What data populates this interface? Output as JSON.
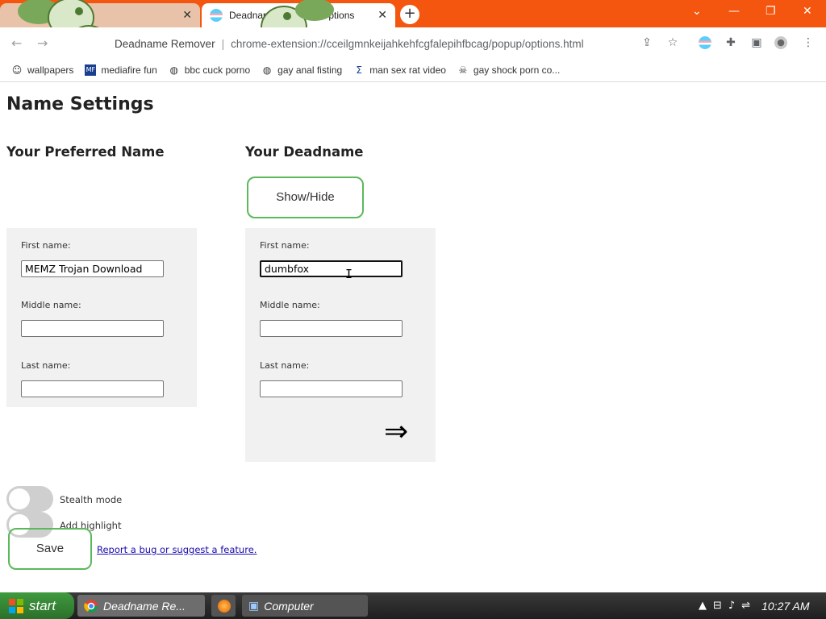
{
  "browser": {
    "tabs": [
      {
        "label": "",
        "active": false
      },
      {
        "label": "Deadname Remover Options",
        "active": true
      }
    ],
    "new_tab": "+",
    "window_controls": {
      "collapse": "⌄",
      "minimize": "—",
      "restore": "❐",
      "close": "✕"
    },
    "nav": {
      "back": "←",
      "forward": "→"
    },
    "address": {
      "site": "Deadname Remover",
      "url": "chrome-extension://cceilgmnkeijahkehfcgfalepihfbcag/popup/options.html"
    },
    "toolbar_icons": {
      "share": "⇪",
      "star": "☆",
      "menu": "⋮"
    }
  },
  "bookmarks": [
    {
      "label": "wallpapers",
      "icon": "snapchat-ghost-icon"
    },
    {
      "label": "mediafire fun",
      "icon": "mediafire-icon"
    },
    {
      "label": "bbc cuck porno",
      "icon": "globe-icon"
    },
    {
      "label": "gay anal fisting",
      "icon": "globe-icon"
    },
    {
      "label": "man sex rat video",
      "icon": "sigma-icon"
    },
    {
      "label": "gay shock porn co...",
      "icon": "skull-icon"
    }
  ],
  "page": {
    "title": "Name Settings",
    "preferred": {
      "heading": "Your Preferred Name",
      "first_label": "First name:",
      "first_value": "MEMZ Trojan Download",
      "middle_label": "Middle name:",
      "middle_value": "",
      "last_label": "Last name:",
      "last_value": ""
    },
    "deadname": {
      "heading": "Your Deadname",
      "show_hide": "Show/Hide",
      "first_label": "First name:",
      "first_value": "dumbfox",
      "middle_label": "Middle name:",
      "middle_value": "",
      "last_label": "Last name:",
      "last_value": "",
      "add_arrow": "⇒"
    },
    "stealth_label": "Stealth mode",
    "highlight_label": "Add highlight",
    "save_label": "Save",
    "report_link": "Report a bug or suggest a feature."
  },
  "taskbar": {
    "start_label": "start",
    "tasks": [
      {
        "label": "Deadname Re...",
        "icon": "chrome-icon"
      },
      {
        "label": "",
        "icon": "firefox-icon"
      },
      {
        "label": "Computer",
        "icon": "computer-icon"
      }
    ],
    "clock": "10:27 AM"
  },
  "colors": {
    "tabbar": "#f4560f",
    "accent_green": "#5cb85c",
    "panel_bg": "#f1f1f1",
    "taskbar_start": "#3f9b3f"
  }
}
